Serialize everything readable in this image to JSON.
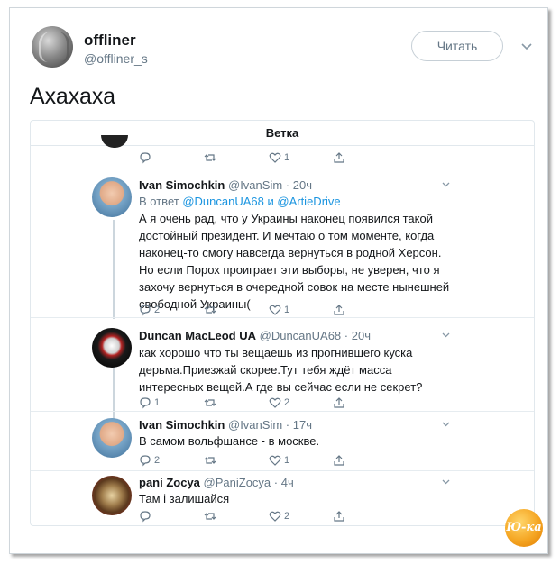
{
  "tweet": {
    "display_name": "offliner",
    "handle": "@offliner_s",
    "follow_label": "Читать",
    "text": "Ахахаха"
  },
  "thread": {
    "header": "Ветка",
    "prev_actions": {
      "reply_count": "",
      "retweet_count": "",
      "like_count": "1"
    },
    "replies": [
      {
        "name": "Ivan Simochkin",
        "handle": "@IvanSim",
        "time": "· 20ч",
        "reply_to_prefix": "В ответ",
        "mention_1": "@DuncanUA68",
        "mention_joiner": "и",
        "mention_2": "@ArtieDrive",
        "body": "А я очень рад, что у Украины наконец появился такой достойный президент. И мечтаю о том моменте, когда наконец-то смогу навсегда вернуться в родной Херсон. Но если Порох проиграет эти выборы, не уверен, что я захочу вернуться в очередной совок на месте нынешней свободной Украины(",
        "reply_count": "2",
        "retweet_count": "",
        "like_count": "1"
      },
      {
        "name": "Duncan MacLeod UA",
        "handle": "@DuncanUA68",
        "time": "· 20ч",
        "body": "как хорошо что ты вещаешь из прогнившего куска дерьма.Приезжай скорее.Тут тебя ждёт масса интересных вещей.А где вы сейчас если не секрет?",
        "reply_count": "1",
        "retweet_count": "",
        "like_count": "2"
      },
      {
        "name": "Ivan Simochkin",
        "handle": "@IvanSim",
        "time": "· 17ч",
        "body": "В самом вольфшансе - в москве.",
        "reply_count": "2",
        "retweet_count": "",
        "like_count": "1"
      },
      {
        "name": "pani Zocya",
        "handle": "@PaniZocya",
        "time": "· 4ч",
        "body": "Там і залишайся",
        "reply_count": "",
        "retweet_count": "",
        "like_count": "2"
      }
    ]
  },
  "watermark_text": "Ю-ка",
  "colors": {
    "accent": "#1b95e0",
    "secondary_text": "#657786",
    "border": "#e1e8ed"
  },
  "icons": [
    "reply-icon",
    "retweet-icon",
    "like-icon",
    "share-icon",
    "chevron-down-icon"
  ]
}
